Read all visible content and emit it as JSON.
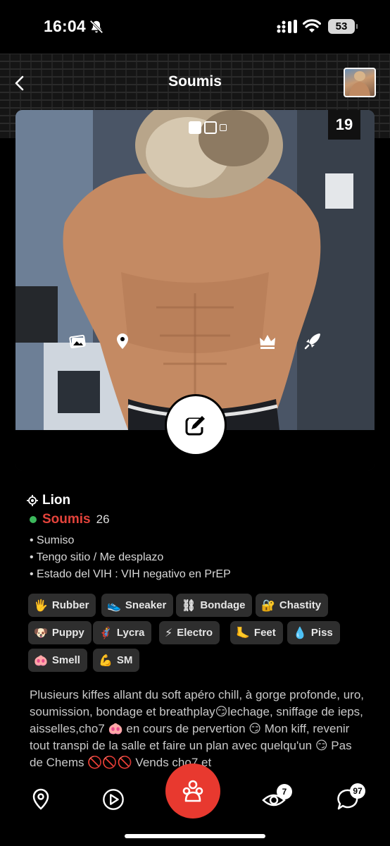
{
  "status_bar": {
    "time": "16:04",
    "battery": "53"
  },
  "header": {
    "title": "Soumis"
  },
  "photo": {
    "count": "19"
  },
  "profile": {
    "location": "Lion",
    "name": "Soumis",
    "age": "26",
    "online_color": "#3cb85c",
    "name_color": "#e4433b",
    "details": [
      "• Sumiso",
      "• Tengo sitio / Me desplazo",
      "• Estado del VIH : VIH negativo en PrEP"
    ]
  },
  "tags": [
    {
      "label": "Rubber",
      "icon": "glove-icon",
      "glyph": "🖐"
    },
    {
      "label": "Sneaker",
      "icon": "sneaker-icon",
      "glyph": "👟"
    },
    {
      "label": "Bondage",
      "icon": "chain-icon",
      "glyph": "⛓"
    },
    {
      "label": "Chastity",
      "icon": "lock-icon",
      "glyph": "🔐"
    },
    {
      "label": "Puppy",
      "icon": "puppy-mask-icon",
      "glyph": "🐶"
    },
    {
      "label": "Lycra",
      "icon": "superhero-icon",
      "glyph": "🦸"
    },
    {
      "label": "Electro",
      "icon": "lightning-icon",
      "glyph": "⚡"
    },
    {
      "label": "Feet",
      "icon": "foot-icon",
      "glyph": "🦶"
    },
    {
      "label": "Piss",
      "icon": "droplet-icon",
      "glyph": "💧"
    },
    {
      "label": "Smell",
      "icon": "pig-nose-icon",
      "glyph": "🐽"
    },
    {
      "label": "SM",
      "icon": "flexed-biceps-icon",
      "glyph": "💪"
    }
  ],
  "bio": "Plusieurs kiffes allant du soft apéro chill, à gorge profonde, uro, soumission, bondage et breathplay😏lechage, sniffage de ieps, aisselles,cho7 🐽 en cours de pervertion 😏 Mon kiff, revenir tout transpi de la salle et faire un plan avec quelqu'un 😏 Pas de Chems 🚫🚫🚫 Vends cho7 et",
  "nav": {
    "views_badge": "7",
    "messages_badge": "97",
    "accent": "#e8392f"
  }
}
